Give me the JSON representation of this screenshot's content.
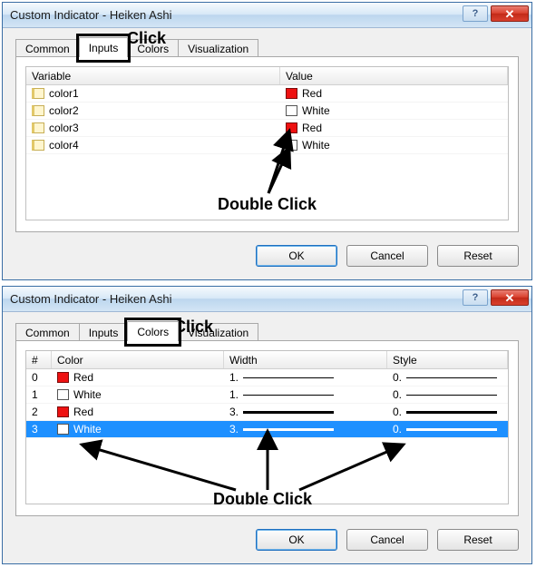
{
  "annotations": {
    "click": "Click",
    "doubleclick": "Double Click"
  },
  "dialog1": {
    "title": "Custom Indicator - Heiken Ashi",
    "tabs": {
      "common": "Common",
      "inputs": "Inputs",
      "colors": "Colors",
      "visualization": "Visualization",
      "active": "inputs"
    },
    "headers": {
      "variable": "Variable",
      "value": "Value"
    },
    "rows": [
      {
        "var": "color1",
        "val": "Red",
        "swatch": "red"
      },
      {
        "var": "color2",
        "val": "White",
        "swatch": "white"
      },
      {
        "var": "color3",
        "val": "Red",
        "swatch": "red"
      },
      {
        "var": "color4",
        "val": "White",
        "swatch": "white"
      }
    ],
    "buttons": {
      "ok": "OK",
      "cancel": "Cancel",
      "reset": "Reset"
    }
  },
  "dialog2": {
    "title": "Custom Indicator - Heiken Ashi",
    "tabs": {
      "common": "Common",
      "inputs": "Inputs",
      "colors": "Colors",
      "visualization": "Visualization",
      "active": "colors"
    },
    "headers": {
      "idx": "#",
      "color": "Color",
      "width": "Width",
      "style": "Style"
    },
    "rows": [
      {
        "idx": "0",
        "color": "Red",
        "swatch": "red",
        "width": "1.",
        "style": "0.",
        "thick": false,
        "sel": false
      },
      {
        "idx": "1",
        "color": "White",
        "swatch": "white",
        "width": "1.",
        "style": "0.",
        "thick": false,
        "sel": false
      },
      {
        "idx": "2",
        "color": "Red",
        "swatch": "red",
        "width": "3.",
        "style": "0.",
        "thick": true,
        "sel": false
      },
      {
        "idx": "3",
        "color": "White",
        "swatch": "white",
        "width": "3.",
        "style": "0.",
        "thick": true,
        "sel": true
      }
    ],
    "buttons": {
      "ok": "OK",
      "cancel": "Cancel",
      "reset": "Reset"
    }
  }
}
